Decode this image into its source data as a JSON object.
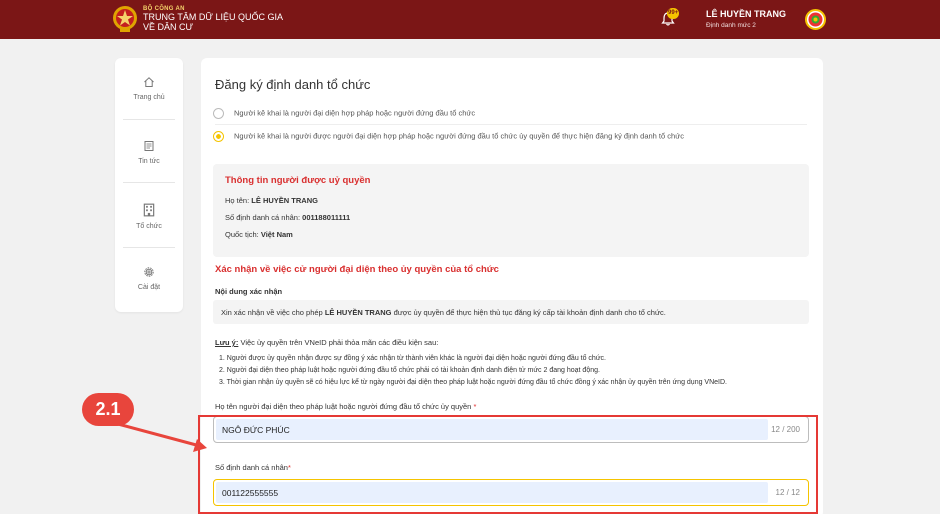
{
  "header": {
    "org_top": "BỘ CÔNG AN",
    "org_line1": "TRUNG TÂM DỮ LIỆU QUỐC GIA",
    "org_line2": "VỀ DÂN CƯ",
    "notification_count": "99+",
    "user_name": "LÊ HUYỀN TRANG",
    "user_level": "Định danh mức 2"
  },
  "sidebar": {
    "items": [
      {
        "label": "Trang chủ",
        "icon": "home-icon"
      },
      {
        "label": "Tin tức",
        "icon": "news-icon"
      },
      {
        "label": "Tổ chức",
        "icon": "building-icon"
      },
      {
        "label": "Cài đặt",
        "icon": "gear-icon"
      }
    ]
  },
  "main": {
    "title": "Đăng ký định danh tổ chức",
    "radio_options": [
      {
        "label": "Người kê khai là người đại diện hợp pháp hoặc người đứng đầu tổ chức",
        "selected": false
      },
      {
        "label": "Người kê khai là người được người đại diện hợp pháp hoặc người đứng đầu tổ chức ủy quyền để thực hiện đăng ký định danh tổ chức",
        "selected": true
      }
    ],
    "authorized": {
      "title": "Thông tin người được uỷ quyền",
      "name_label": "Họ tên:",
      "name_value": "LÊ HUYỀN TRANG",
      "id_label": "Số định danh cá nhân:",
      "id_value": "001188011111",
      "nationality_label": "Quốc tịch:",
      "nationality_value": "Việt Nam"
    },
    "confirm_title": "Xác nhận về việc cử người đại diện theo ủy quyền của tổ chức",
    "content_label": "Nội dung xác nhận",
    "content_prefix": "Xin xác nhận về việc cho phép",
    "content_name": "LÊ HUYỀN TRANG",
    "content_suffix": "được ủy quyền để thực hiện thủ tục đăng ký cấp tài khoản định danh cho tổ chức.",
    "note_label": "Lưu ý:",
    "note_text": "Việc ủy quyền trên VNeID phải thỏa mãn các điều kiện sau:",
    "conditions": [
      "1.  Người được ủy quyền nhận được sự đồng ý xác nhận từ thành viên khác là người đại diện hoặc người đứng đầu tổ chức.",
      "2.  Người đại diện theo pháp luật hoặc người đứng đầu tổ chức phải có tài khoản định danh điện tử mức 2 đang hoạt động.",
      "3.  Thời gian nhận ủy quyền sẽ có hiệu lực kể từ ngày người đại diện theo pháp luật hoặc người đứng đầu tổ chức đồng ý xác nhận ủy quyền trên ứng dụng VNeID."
    ],
    "rep_name_label": "Họ tên người đại diện theo pháp luật hoặc người đứng đầu tổ chức ủy quyền",
    "rep_name_value": "NGÔ ĐỨC PHÚC",
    "rep_name_count": "12 / 200",
    "rep_id_label": "Số định danh cá nhân",
    "rep_id_value": "001122555555",
    "rep_id_count": "12 / 12",
    "required_mark": "*"
  },
  "annotation": {
    "callout": "2.1",
    "color": "#e53935"
  },
  "colors": {
    "header": "#7b1616",
    "accent": "#f5c400",
    "title_red": "#d92f2f"
  }
}
